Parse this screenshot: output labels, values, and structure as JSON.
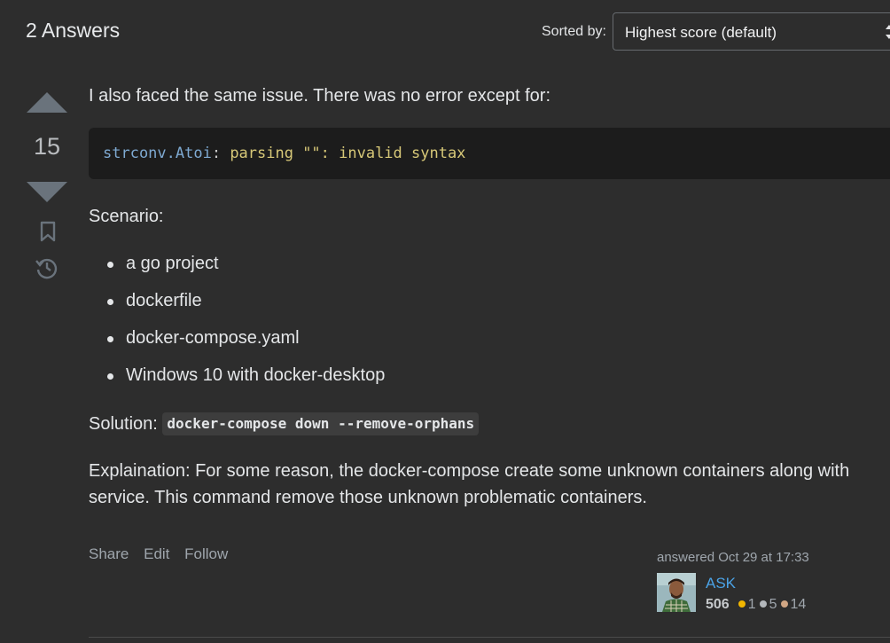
{
  "header": {
    "answers_title": "2 Answers",
    "sort_label": "Sorted by:",
    "sort_value": "Highest score (default)"
  },
  "votes": {
    "count": "15"
  },
  "icons": {
    "upvote": "triangle-up-icon",
    "downvote": "triangle-down-icon",
    "bookmark": "bookmark-icon",
    "history": "history-icon",
    "sort": "chevron-updown-icon"
  },
  "answer": {
    "intro": "I also faced the same issue. There was no error except for:",
    "code_fn": "strconv.Atoi",
    "code_colon": ":",
    "code_rest": " parsing \"\": invalid syntax",
    "scenario": "Scenario:",
    "items": [
      "a go project",
      "dockerfile",
      "docker-compose.yaml",
      "Windows 10 with docker-desktop"
    ],
    "solution_label": "Solution:",
    "solution_code": "docker-compose down --remove-orphans",
    "explanation": "Explaination: For some reason, the docker-compose create some unknown containers along with service. This command remove those unknown problematic containers."
  },
  "menu": {
    "share": "Share",
    "edit": "Edit",
    "follow": "Follow"
  },
  "user": {
    "answered": "answered Oct 29 at 17:33",
    "name": "ASK",
    "reputation": "506",
    "gold": "1",
    "silver": "5",
    "bronze": "14"
  },
  "colors": {
    "background": "#2d2d2d",
    "link": "#4ba3e6",
    "code_bg": "#1c1c1c"
  }
}
